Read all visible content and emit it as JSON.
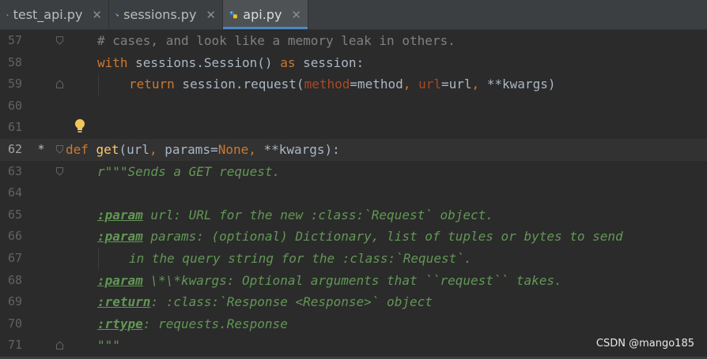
{
  "tabs": [
    {
      "label": "test_api.py",
      "close": "✕",
      "active": false
    },
    {
      "label": "sessions.py",
      "close": "✕",
      "active": false
    },
    {
      "label": "api.py",
      "close": "✕",
      "active": true
    }
  ],
  "lines": [
    {
      "num": "57",
      "mark": ""
    },
    {
      "num": "58",
      "mark": ""
    },
    {
      "num": "59",
      "mark": ""
    },
    {
      "num": "60",
      "mark": ""
    },
    {
      "num": "61",
      "mark": ""
    },
    {
      "num": "62",
      "mark": "*"
    },
    {
      "num": "63",
      "mark": ""
    },
    {
      "num": "64",
      "mark": ""
    },
    {
      "num": "65",
      "mark": ""
    },
    {
      "num": "66",
      "mark": ""
    },
    {
      "num": "67",
      "mark": ""
    },
    {
      "num": "68",
      "mark": ""
    },
    {
      "num": "69",
      "mark": ""
    },
    {
      "num": "70",
      "mark": ""
    },
    {
      "num": "71",
      "mark": ""
    }
  ],
  "code": {
    "l57": {
      "comment": "# cases, and look like a memory leak in others."
    },
    "l58": {
      "kw1": "with",
      "t1": " sessions.Session() ",
      "kw2": "as",
      "t2": " session:"
    },
    "l59": {
      "kw": "return",
      "t1": " session.request(",
      "p1": "method",
      "t2": "=method",
      "c1": ", ",
      "p2": "url",
      "t3": "=url",
      "c2": ", ",
      "t4": "**kwargs)"
    },
    "l62": {
      "kw": "def",
      "sp": " ",
      "fn": "get",
      "t1": "(url",
      "c1": ", ",
      "t2": "params=",
      "kw2": "None",
      "c2": ", ",
      "t3": "**kwargs):"
    },
    "l63": {
      "doc": "r\"\"\"Sends a GET request."
    },
    "l65": {
      "tag": ":param",
      "doc": " url: URL for the new :class:`Request` object."
    },
    "l66": {
      "tag": ":param",
      "doc": " params: (optional) Dictionary, list of tuples or bytes to send"
    },
    "l67": {
      "doc": "in the query string for the :class:`Request`."
    },
    "l68": {
      "tag": ":param",
      "doc": " \\*\\*kwargs: Optional arguments that ``request`` takes."
    },
    "l69": {
      "tag": ":return",
      "doc": ": :class:`Response <Response>` object"
    },
    "l70": {
      "tag": ":rtype",
      "doc": ": requests.Response"
    },
    "l71": {
      "doc": "\"\"\""
    }
  },
  "colors": {
    "background": "#2b2b2b",
    "keyword": "#cc7832",
    "function": "#ffc66d",
    "comment": "#808080",
    "param": "#aa4926",
    "docstring": "#629755",
    "text": "#a9b7c6"
  },
  "icons": {
    "tab_file": "python-file-icon",
    "intention": "lightbulb-icon",
    "fold": "fold-marker-icon"
  },
  "watermark": "CSDN @mango185"
}
